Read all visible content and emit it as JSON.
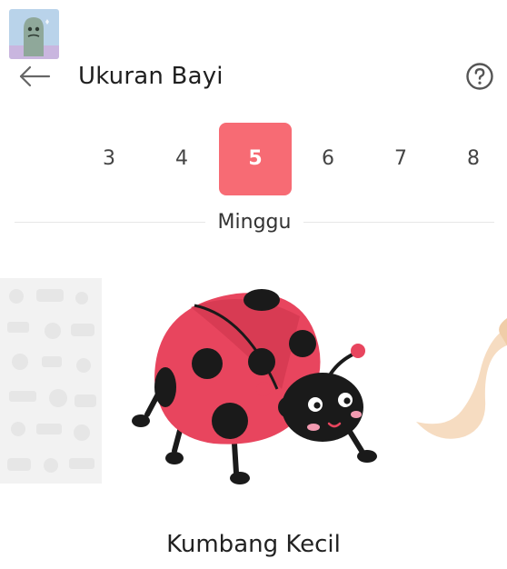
{
  "header": {
    "title": "Ukuran Bayi",
    "back_icon": "arrow-left-icon",
    "help_icon": "question-circle-icon"
  },
  "weeks": {
    "items": [
      "3",
      "4",
      "5",
      "6",
      "7",
      "8"
    ],
    "selected": "5",
    "unit_label": "Minggu"
  },
  "baby": {
    "size_label": "Kumbang Kecil",
    "image": "ladybug-illustration"
  },
  "colors": {
    "accent": "#f76b74",
    "ladybug_body": "#e8455e",
    "ladybug_spots": "#1a1a1a"
  }
}
